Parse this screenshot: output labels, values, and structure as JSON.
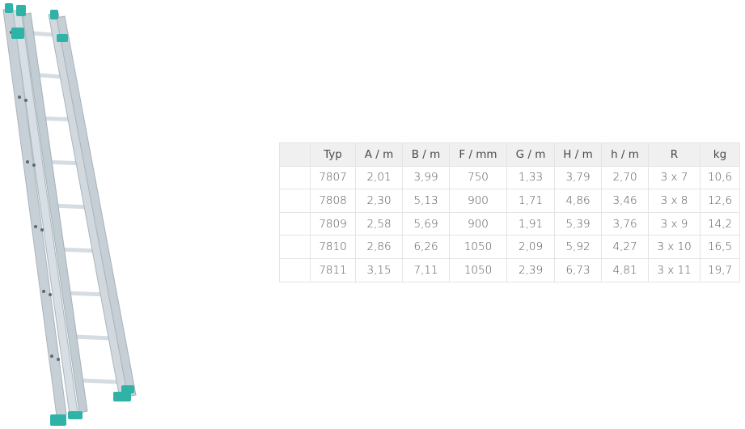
{
  "product_image": {
    "icon": "extension-ladder-illustration",
    "rail_color": "#c9d2d8",
    "accent_color": "#2eb3a6"
  },
  "spec_table": {
    "headers": [
      "",
      "Typ",
      "A / m",
      "B / m",
      "F / mm",
      "G / m",
      "H / m",
      "h / m",
      "R",
      "kg"
    ],
    "rows": [
      [
        "",
        "7807",
        "2,01",
        "3,99",
        "750",
        "1,33",
        "3,79",
        "2,70",
        "3 x 7",
        "10,6"
      ],
      [
        "",
        "7808",
        "2,30",
        "5,13",
        "900",
        "1,71",
        "4,86",
        "3,46",
        "3 x 8",
        "12,6"
      ],
      [
        "",
        "7809",
        "2,58",
        "5,69",
        "900",
        "1,91",
        "5,39",
        "3,76",
        "3 x 9",
        "14,2"
      ],
      [
        "",
        "7810",
        "2,86",
        "6,26",
        "1050",
        "2,09",
        "5,92",
        "4,27",
        "3 x 10",
        "16,5"
      ],
      [
        "",
        "7811",
        "3,15",
        "7,11",
        "1050",
        "2,39",
        "6,73",
        "4,81",
        "3 x 11",
        "19,7"
      ]
    ]
  }
}
